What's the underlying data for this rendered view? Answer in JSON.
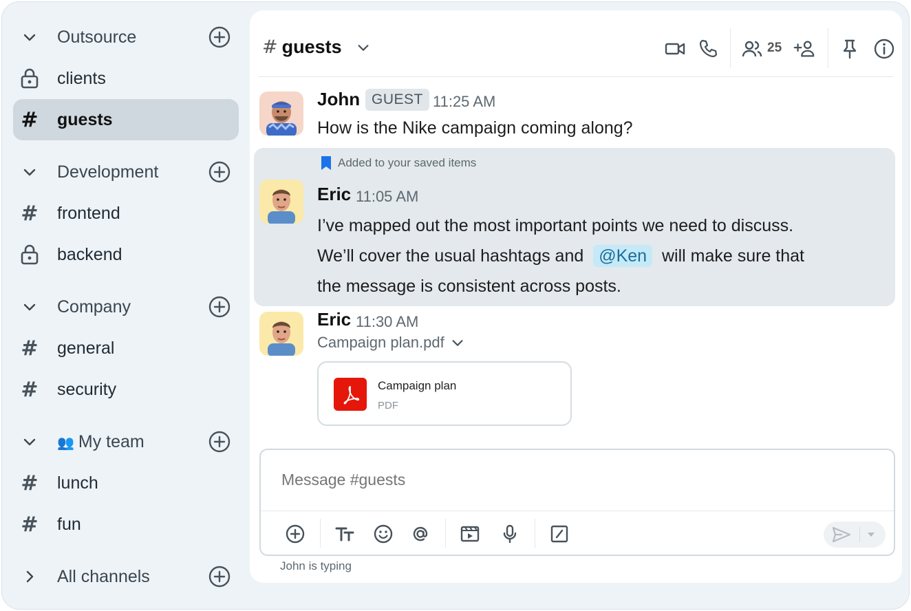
{
  "sidebar": {
    "groups": [
      {
        "label": "Outsource",
        "items": [
          {
            "label": "clients",
            "icon": "lock-icon"
          },
          {
            "label": "guests",
            "icon": "hash-icon",
            "active": true
          }
        ]
      },
      {
        "label": "Development",
        "items": [
          {
            "label": "frontend",
            "icon": "hash-icon"
          },
          {
            "label": "backend",
            "icon": "lock-icon"
          }
        ]
      },
      {
        "label": "Company",
        "items": [
          {
            "label": "general",
            "icon": "hash-icon"
          },
          {
            "label": "security",
            "icon": "hash-icon"
          }
        ]
      },
      {
        "label": "My team",
        "emoji": "👥",
        "items": [
          {
            "label": "lunch",
            "icon": "hash-icon"
          },
          {
            "label": "fun",
            "icon": "hash-icon"
          }
        ]
      }
    ],
    "all_channels": "All channels"
  },
  "header": {
    "hash": "#",
    "channel": "guests",
    "member_count": "25"
  },
  "messages": [
    {
      "sender": "John",
      "badge": "GUEST",
      "time": "11:25 AM",
      "text": "How is the Nike campaign coming along?"
    },
    {
      "saved_note": "Added to your saved items",
      "sender": "Eric",
      "time": "11:05 AM",
      "line1": "I’ve mapped out the most important points we need to discuss.",
      "line2_pre": "We’ll cover the usual hashtags and",
      "mention": "@Ken",
      "line2_post": "will make sure that",
      "line3": "the message is consistent across posts."
    },
    {
      "sender": "Eric",
      "time": "11:30 AM",
      "file_name": "Campaign plan.pdf",
      "file_title": "Campaign plan",
      "file_type": "PDF"
    }
  ],
  "composer": {
    "placeholder": "Message #guests"
  },
  "typing": "John is typing",
  "colors": {
    "accent_blue": "#1a73e8",
    "pdf_red": "#e5170b",
    "mention_bg": "#c6e9f8"
  }
}
